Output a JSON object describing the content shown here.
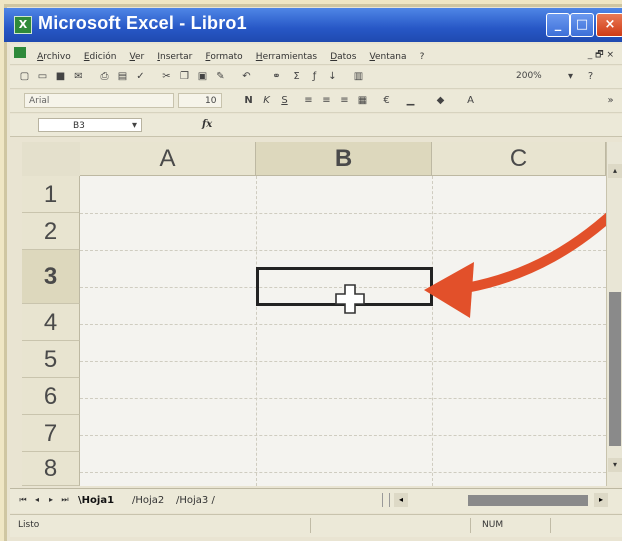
{
  "window": {
    "title": "Microsoft Excel - Libro1"
  },
  "menu": {
    "items": [
      "Archivo",
      "Edición",
      "Ver",
      "Insertar",
      "Formato",
      "Herramientas",
      "Datos",
      "Ventana",
      "?"
    ],
    "right_controls": "_ 🗗 ×"
  },
  "toolbar": {
    "zoom": "200%",
    "font_name": "Arial",
    "font_size": "10"
  },
  "formula_bar": {
    "name_box": "B3",
    "fx": "fx"
  },
  "grid": {
    "columns": [
      "A",
      "B",
      "C"
    ],
    "rows": [
      "1",
      "2",
      "3",
      "4",
      "5",
      "6",
      "7",
      "8"
    ],
    "active_cell": "B3"
  },
  "sheets": {
    "tabs": [
      "Hoja1",
      "Hoja2",
      "Hoja3"
    ],
    "active": "Hoja1"
  },
  "status": {
    "left": "Listo",
    "num": "NUM"
  },
  "colors": {
    "title_bar": "#2757c6",
    "arrow": "#e2502a",
    "active_border": "#222222"
  }
}
